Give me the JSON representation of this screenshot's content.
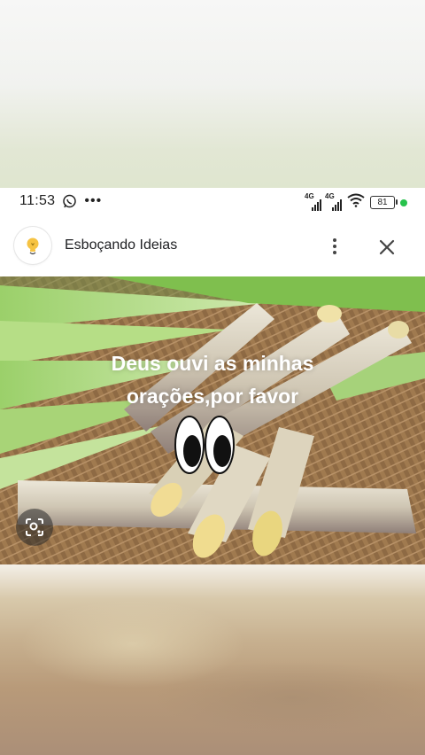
{
  "status_bar": {
    "time": "11:53",
    "network1": "4G",
    "network2": "4G",
    "battery": "81"
  },
  "header": {
    "title": "Esboçando Ideias"
  },
  "post": {
    "caption_line1": "Deus ouvi as minhas",
    "caption_line2": "orações,por favor"
  },
  "icons": [
    "whatsapp-icon",
    "more-icon",
    "lightbulb-logo-icon",
    "kebab-menu-icon",
    "close-icon",
    "image-search-icon"
  ],
  "colors": {
    "status_dot": "#27c24c",
    "caption_text": "#ffffff"
  }
}
